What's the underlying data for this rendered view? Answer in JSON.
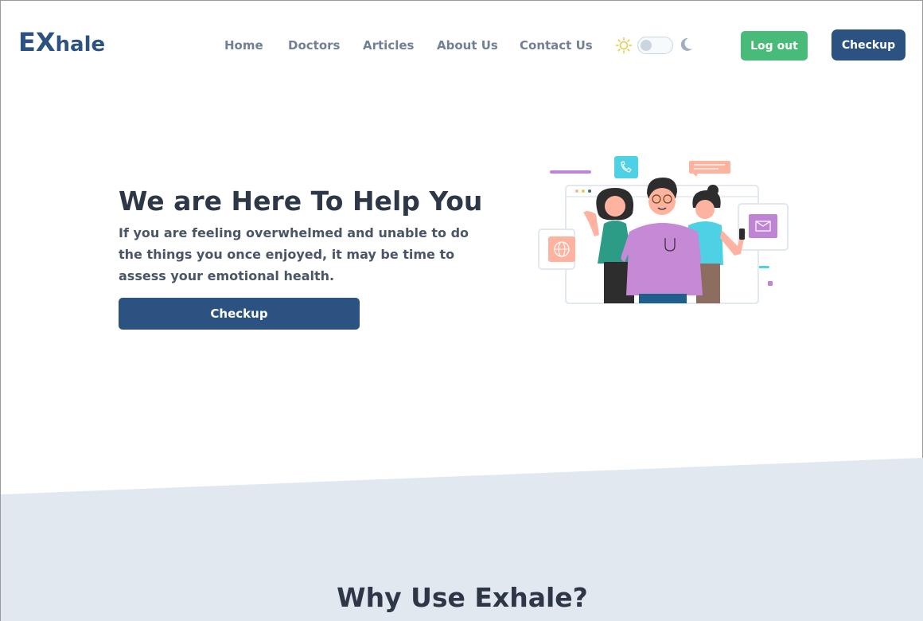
{
  "brand": {
    "logo_big": "EX",
    "logo_small": "hale"
  },
  "nav": {
    "links": [
      "Home",
      "Doctors",
      "Articles",
      "About Us",
      "Contact Us"
    ],
    "logout_label": "Log out",
    "checkup_label": "Checkup"
  },
  "theme_toggle": {
    "sun_icon": "sun-icon",
    "moon_icon": "moon-icon",
    "mode": "light"
  },
  "hero": {
    "title": "We are Here To Help You",
    "text": "If you are feeling overwhelmed and unable to do the things you once enjoyed, it may be time to assess your emotional health.",
    "button_label": "Checkup"
  },
  "section": {
    "title": "Why Use Exhale?"
  },
  "colors": {
    "brand": "#2c5282",
    "logout": "#48bb78",
    "section_bg": "#e2e8f0",
    "nav_text": "#718096"
  }
}
